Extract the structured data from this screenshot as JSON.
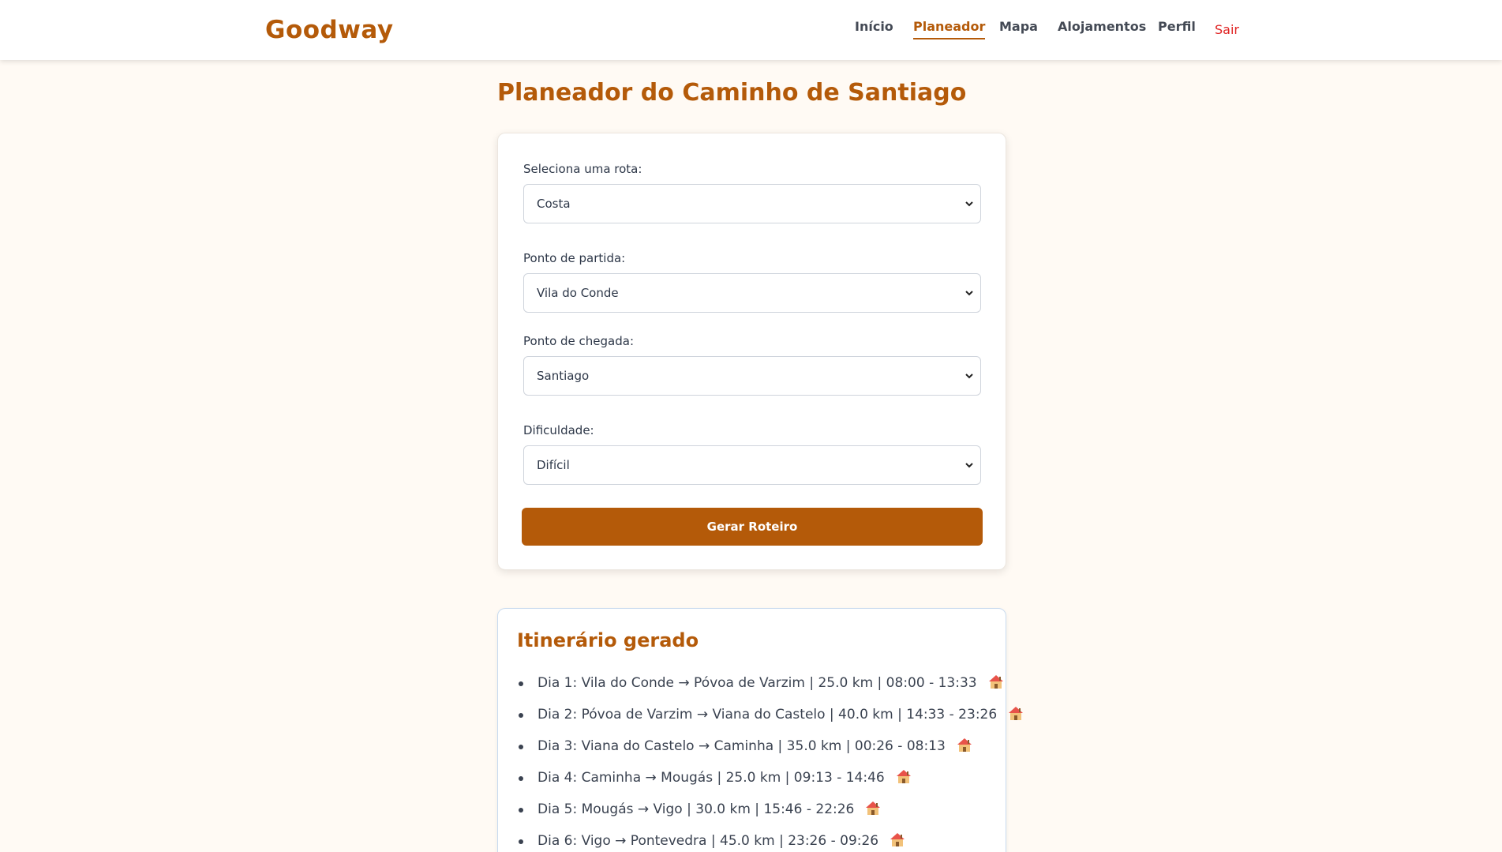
{
  "header": {
    "brand": "Goodway",
    "nav": {
      "inicio": "Início",
      "planeador": "Planeador",
      "mapa": "Mapa",
      "alojamentos": "Alojamentos",
      "perfil": "Perfil",
      "sair": "Sair"
    },
    "active_nav": "Planeador"
  },
  "page": {
    "title": "Planeador do Caminho de Santiago"
  },
  "form": {
    "route_label": "Seleciona uma rota:",
    "route_value": "Costa",
    "start_label": "Ponto de partida:",
    "start_value": "Vila do Conde",
    "end_label": "Ponto de chegada:",
    "end_value": "Santiago",
    "difficulty_label": "Dificuldade:",
    "difficulty_value": "Difícil",
    "submit_label": "Gerar Roteiro"
  },
  "itinerary": {
    "title": "Itinerário gerado",
    "items": [
      "Dia 1: Vila do Conde → Póvoa de Varzim | 25.0 km | 08:00 - 13:33",
      "Dia 2: Póvoa de Varzim → Viana do Castelo | 40.0 km | 14:33 - 23:26",
      "Dia 3: Viana do Castelo → Caminha | 35.0 km | 00:26 - 08:13",
      "Dia 4: Caminha → Mougás | 25.0 km | 09:13 - 14:46",
      "Dia 5: Mougás → Vigo | 30.0 km | 15:46 - 22:26",
      "Dia 6: Vigo → Pontevedra | 45.0 km | 23:26 - 09:26"
    ],
    "item_icon": "house-icon"
  },
  "colors": {
    "brand": "#b45a09",
    "background": "#fffaf4",
    "logout": "#e02424",
    "itinerary_border": "#c9dbef"
  }
}
